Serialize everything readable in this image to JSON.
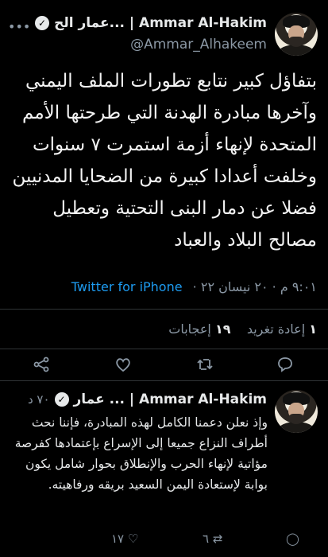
{
  "tweet": {
    "display_name": "عمار الح... | Ammar Al-Hakim",
    "handle": "@Ammar_Alhakeem",
    "text": "بتفاؤل كبير نتابع تطورات الملف اليمني وآخرها مبادرة الهدنة التي طرحتها الأمم المتحدة لإنهاء أزمة استمرت ٧ سنوات وخلفت أعدادا كبيرة من الضحايا المدنيين فضلا عن دمار البنى التحتية وتعطيل مصالح البلاد والعباد",
    "timestamp": "٩:٠١ م · ٢٠ نيسان ٢٢ ·",
    "source": "Twitter for iPhone",
    "stats": {
      "retweets_count": "١",
      "retweets_label": "إعادة تغريد",
      "likes_count": "١٩",
      "likes_label": "إعجابات"
    }
  },
  "reply": {
    "display_name": "عمار ... | Ammar Al-Hakim",
    "time": "٧٠ د",
    "text": "وإذ نعلن دعمنا الكامل لهذه المبادرة، فإننا نحث أطراف النزاع جميعا إلى الإسراع بإعتمادها كفرصة مؤاتية لإنهاء الحرب والإنطلاق بحوار شامل يكون بوابة لإستعادة اليمن السعيد بريقه ورفاهيته.",
    "likes_count": "١٧",
    "retweets_count": "٦"
  }
}
